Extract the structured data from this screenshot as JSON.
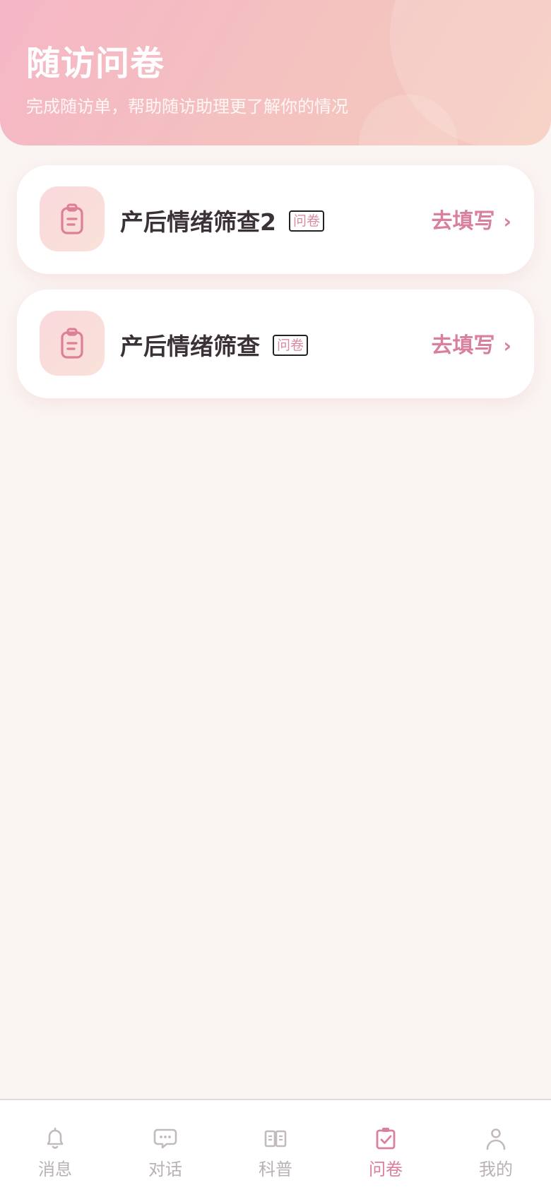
{
  "header": {
    "title": "随访问卷",
    "subtitle": "完成随访单，帮助随访助理更了解你的情况"
  },
  "questionnaires": [
    {
      "title": "产后情绪筛查2",
      "badge": "问卷",
      "action": "去填写",
      "icon": "clipboard-icon"
    },
    {
      "title": "产后情绪筛查",
      "badge": "问卷",
      "action": "去填写",
      "icon": "clipboard-icon"
    }
  ],
  "nav": {
    "items": [
      {
        "label": "消息",
        "icon": "bell-icon",
        "active": false
      },
      {
        "label": "对话",
        "icon": "chat-bubble-icon",
        "active": false
      },
      {
        "label": "科普",
        "icon": "book-icon",
        "active": false
      },
      {
        "label": "问卷",
        "icon": "clipboard-check-icon",
        "active": true
      },
      {
        "label": "我的",
        "icon": "user-icon",
        "active": false
      }
    ]
  },
  "colors": {
    "accent": "#d9809c",
    "inactive": "#b9b1b4",
    "background": "#faf4f2",
    "header_gradient_start": "#f5b6c6",
    "header_gradient_end": "#f5cbbd"
  }
}
